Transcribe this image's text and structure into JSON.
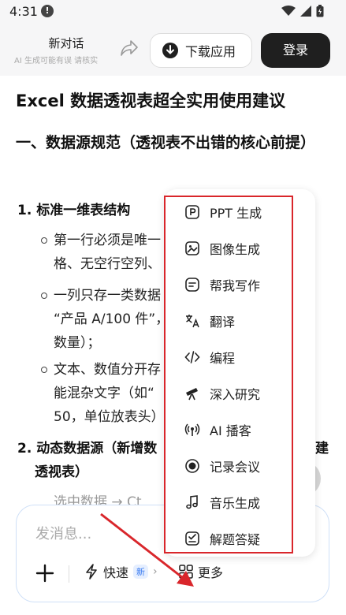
{
  "status": {
    "time": "4:31",
    "info_glyph": "!"
  },
  "header": {
    "title": "新对话",
    "subtitle": "AI 生成可能有误 请核实",
    "download_label": "下载应用",
    "login_label": "登录"
  },
  "article": {
    "title": "Excel 数据透视表超全实用使用建议",
    "section1": "一、数据源规范（透视表不出错的核心前提）",
    "item1": {
      "title": "1. 标准一维表结构",
      "bullets": [
        "第一行必须是唯一",
        "格、无空行空列、",
        "一列只存一类数据",
        "“产品 A/100 件”，",
        "数量）；",
        "文本、数值分开存",
        "能混杂文字（如“",
        "50，单位放表头）"
      ]
    },
    "item2": {
      "title": "2. 动态数据源（新增数",
      "title_tail": "建",
      "line2": "透视表）",
      "cut": "选中数据 → Ct"
    }
  },
  "menu": {
    "items": [
      {
        "label": "PPT 生成",
        "icon": "ppt-icon"
      },
      {
        "label": "图像生成",
        "icon": "image-icon"
      },
      {
        "label": "帮我写作",
        "icon": "writing-icon"
      },
      {
        "label": "翻译",
        "icon": "translate-icon"
      },
      {
        "label": "编程",
        "icon": "code-icon"
      },
      {
        "label": "深入研究",
        "icon": "telescope-icon"
      },
      {
        "label": "AI 播客",
        "icon": "podcast-icon"
      },
      {
        "label": "记录会议",
        "icon": "record-icon"
      },
      {
        "label": "音乐生成",
        "icon": "music-icon"
      },
      {
        "label": "解题答疑",
        "icon": "solve-icon"
      }
    ]
  },
  "composer": {
    "placeholder": "发消息...",
    "quick_label": "快速",
    "new_badge": "新",
    "more_label": "更多"
  },
  "colors": {
    "highlight": "#d9262b",
    "login_bg": "#1f1f1f",
    "accent": "#3a7bf0"
  }
}
